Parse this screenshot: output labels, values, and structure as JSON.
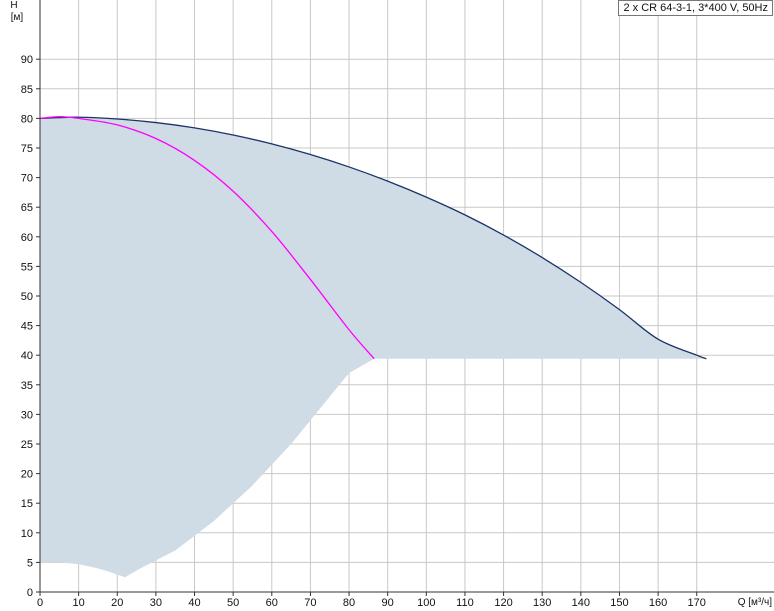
{
  "chart_data": {
    "type": "area",
    "legend": "2 x CR 64-3-1, 3*400 V, 50Hz",
    "xlabel": "Q [м³/ч]",
    "ylabel": "H",
    "ylabel_unit": "[м]",
    "xlim": [
      0,
      190
    ],
    "ylim": [
      0,
      100
    ],
    "xticks": [
      0,
      10,
      20,
      30,
      40,
      50,
      60,
      70,
      80,
      90,
      100,
      110,
      120,
      130,
      140,
      150,
      160,
      170
    ],
    "yticks": [
      0,
      5,
      10,
      15,
      20,
      25,
      30,
      35,
      40,
      45,
      50,
      55,
      60,
      65,
      70,
      75,
      80,
      85,
      90
    ],
    "grid": true,
    "colors": {
      "area": "#cfdbe5",
      "curve_max": "#1c3368",
      "curve_single": "#ff00ff",
      "grid": "#c8c8c8"
    },
    "series": [
      {
        "name": "2 x CR 64-3-1, 3*400 V, 50Hz",
        "x": [
          0,
          10,
          20,
          30,
          40,
          50,
          60,
          70,
          80,
          90,
          100,
          110,
          120,
          130,
          140,
          150,
          160,
          170,
          172.5
        ],
        "y": [
          80.0,
          80.2,
          79.9,
          79.3,
          78.4,
          77.2,
          75.7,
          73.9,
          71.8,
          69.4,
          66.7,
          63.7,
          60.3,
          56.5,
          52.3,
          47.7,
          42.7,
          40.0,
          39.4
        ]
      },
      {
        "x": [
          0,
          5,
          10,
          20,
          30,
          40,
          50,
          60,
          70,
          80,
          86.5
        ],
        "y": [
          80.0,
          80.3,
          80.0,
          78.9,
          76.6,
          72.9,
          67.7,
          60.9,
          52.8,
          44.3,
          39.4
        ]
      }
    ],
    "lower_boundary": {
      "x": [
        0,
        5,
        10,
        15,
        18,
        22,
        26,
        35,
        45,
        55,
        65,
        75,
        80,
        86.5
      ],
      "y": [
        5.0,
        5.0,
        4.7,
        4.0,
        3.4,
        2.5,
        4.0,
        7.0,
        12.0,
        18.0,
        25.0,
        33.0,
        37.0,
        39.4
      ]
    }
  }
}
